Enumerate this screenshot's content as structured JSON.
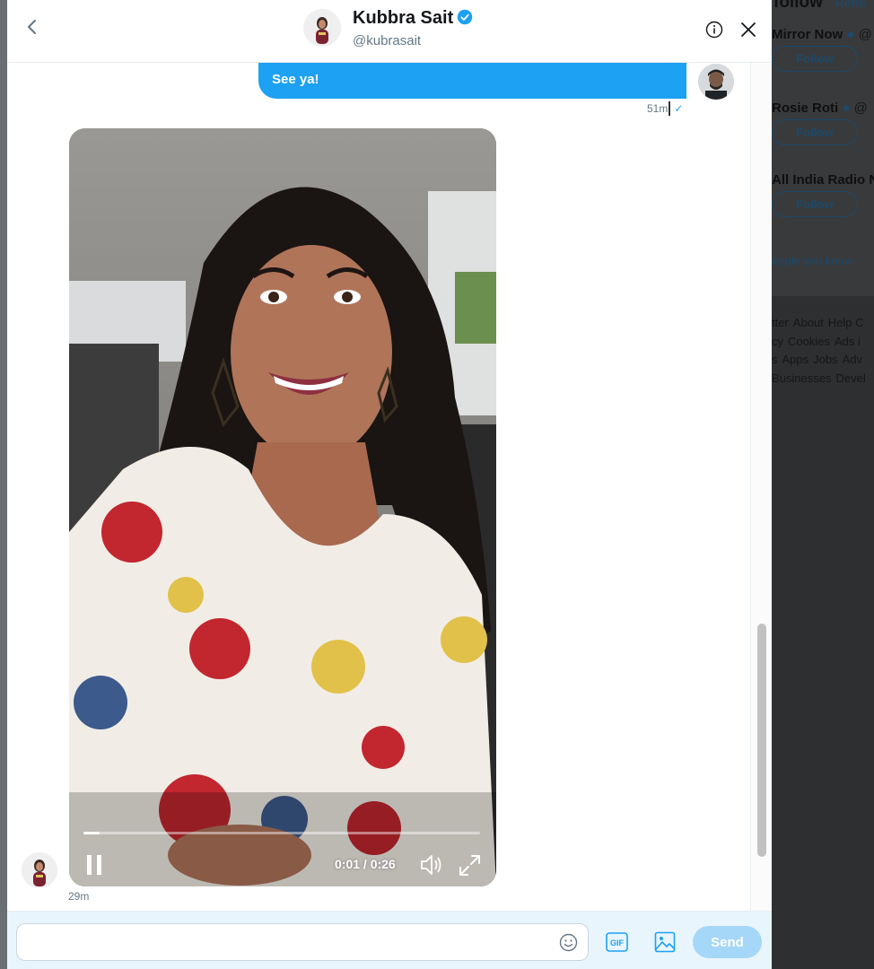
{
  "header": {
    "name": "Kubbra Sait",
    "handle": "@kubrasait"
  },
  "messages": {
    "sent": {
      "text": "See ya!",
      "time": "51m"
    },
    "received_video": {
      "time": "29m",
      "video_time": "0:01 / 0:26",
      "progress": 0.04
    }
  },
  "composer": {
    "placeholder": "",
    "gif_label": "GIF",
    "send_label": "Send"
  },
  "background": {
    "heading": "follow",
    "refresh": "· Refre",
    "who_to_follow": [
      {
        "name": "Mirror Now",
        "handle": "@",
        "follow": "Follow"
      },
      {
        "name": "Rosie Roti",
        "handle": "@",
        "follow": "Follow"
      },
      {
        "name": "All India Radio N",
        "handle": "",
        "follow": "Follow"
      }
    ],
    "people_link": "eople you know",
    "footer": [
      "tter",
      "About",
      "Help C",
      "cy",
      "Cookies",
      "Ads i",
      "s",
      "Apps",
      "Jobs",
      "Adv",
      "Businesses",
      "Devel"
    ]
  },
  "colors": {
    "accent": "#1da1f2",
    "send_disabled": "#a5d7f8",
    "muted": "#657786"
  }
}
